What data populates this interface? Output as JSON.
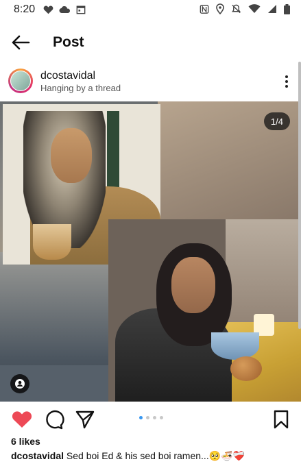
{
  "status_bar": {
    "time": "8:20"
  },
  "app_bar": {
    "title": "Post"
  },
  "post": {
    "username": "dcostavidal",
    "subtitle": "Hanging by a thread",
    "image_counter": "1/4",
    "current_image": 1,
    "image_count": 4,
    "likes": "6 likes",
    "caption_user": "dcostavidal",
    "caption_text": "Sed boi Ed & his sed boi ramen...🥺🍜❤️‍🩹"
  },
  "icons": {
    "back": "arrow-left-icon",
    "more": "more-vertical-icon",
    "like": "heart-filled-icon",
    "comment": "comment-bubble-icon",
    "share": "paper-plane-icon",
    "save": "bookmark-icon",
    "tag": "user-tag-icon"
  },
  "colors": {
    "like_red": "#ed4956",
    "dot_active": "#3897f0",
    "dot_inactive": "#c8c8c8"
  }
}
